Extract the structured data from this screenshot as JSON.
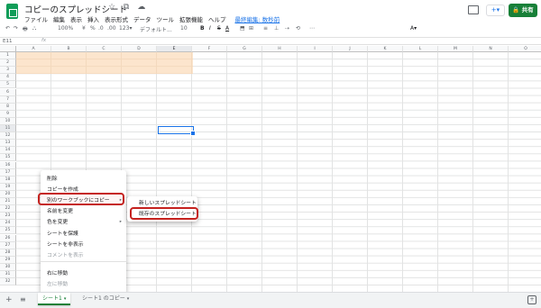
{
  "app": {
    "doc_title": "コピーのスプレッドシート",
    "title_icons": "☆ ⧉ ☁",
    "menu": [
      "ファイル",
      "編集",
      "表示",
      "挿入",
      "表示形式",
      "データ",
      "ツール",
      "拡張機能",
      "ヘルプ"
    ],
    "last_edit": "最終編集: 数秒前",
    "share_label": "🔒 共有",
    "present_label": "+▾",
    "brand_color": "#0f9d58"
  },
  "toolbar": {
    "items": [
      "↶",
      "↷",
      "🖶",
      "⛬",
      "100%",
      "¥",
      "%",
      ".0",
      ".00",
      "123▾",
      "デフォルト...",
      "10",
      "B",
      "I",
      "S",
      "A",
      "⬒",
      "⊞",
      "≡",
      "⊥",
      "⇢",
      "⟲",
      "⋯",
      "A▾"
    ]
  },
  "formula": {
    "cell_ref": "E11",
    "fx": "fx"
  },
  "grid": {
    "columns": [
      "A",
      "B",
      "C",
      "D",
      "E",
      "F",
      "G",
      "H",
      "I",
      "J",
      "K",
      "L",
      "M",
      "N",
      "O"
    ],
    "rows": [
      "1",
      "2",
      "3",
      "4",
      "5",
      "6",
      "7",
      "8",
      "9",
      "10",
      "11",
      "12",
      "13",
      "14",
      "15",
      "16",
      "17",
      "18",
      "19",
      "20",
      "21",
      "22",
      "23",
      "24",
      "25",
      "26",
      "27",
      "28",
      "29",
      "30",
      "31",
      "32"
    ],
    "fill_color": "#fce5cd"
  },
  "context_menu": {
    "items": [
      {
        "label": "削除",
        "disabled": false
      },
      {
        "label": "コピーを作成",
        "disabled": false
      },
      {
        "label": "別のワークブックにコピー",
        "disabled": false,
        "arrow": "▸"
      },
      {
        "label": "名前を変更",
        "disabled": false
      },
      {
        "label": "色を変更",
        "disabled": false,
        "arrow": "▸"
      },
      {
        "label": "シートを保護",
        "disabled": false
      },
      {
        "label": "シートを非表示",
        "disabled": false
      },
      {
        "label": "コメントを表示",
        "disabled": true
      },
      {
        "label": "右に移動",
        "disabled": false
      },
      {
        "label": "左に移動",
        "disabled": true
      }
    ],
    "highlight_color": "#c5221f"
  },
  "submenu": {
    "items": [
      "新しいスプレッドシート",
      "既存のスプレッドシート"
    ]
  },
  "sheets": {
    "add": "+",
    "all": "≡",
    "tabs": [
      {
        "label": "シート1",
        "caret": "▾"
      },
      {
        "label": "シート1 のコピー",
        "caret": "▾"
      }
    ],
    "explore": "+"
  }
}
